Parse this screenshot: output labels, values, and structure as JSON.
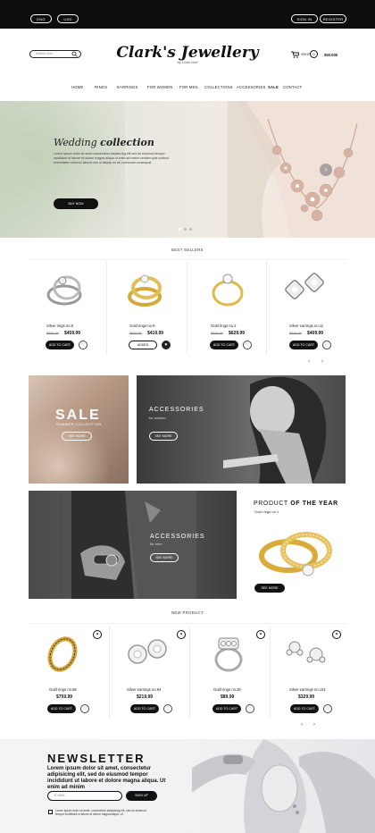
{
  "topbar": {
    "lang": "ENG",
    "currency": "USD",
    "sign_in": "SIGN IN",
    "register": "REGISTER"
  },
  "header": {
    "search_placeholder": "Search here",
    "logo": "Clark's Jewellery",
    "logo_sub": "by Clark Doe",
    "shop_label": "SHOP",
    "cart_count": "0",
    "cart_total": "$50.00$"
  },
  "nav": [
    "HOME",
    "RINGS",
    "EARRINGS",
    "FOR WOMEN",
    "FOR MEN",
    "COLLECTIONS",
    "ACCESSORIES",
    "SALE",
    "CONTACT"
  ],
  "hero": {
    "title_light": "Wedding",
    "title_bold": "collection",
    "text": "Lorem ipsum dolor sit amet consectetur adipisicing elit sed do eiusmod tempor incididunt ut labore et dolore magna aliqua ut enim ad minim veniam quis nostrud exercitation ullamco laboris nisi ut aliquip ex ea commodo consequat",
    "button": "BUY NOW"
  },
  "best_sellers": {
    "title": "BEST SELLERS",
    "items": [
      {
        "name": "Silver rings no.5",
        "old": "$688.99",
        "price": "$459.99",
        "button": "ADD TO CART"
      },
      {
        "name": "Gold rings no.9",
        "old": "$699.99",
        "price": "$419.99",
        "button": "ADDED"
      },
      {
        "name": "Gold rings no.2",
        "old": "$899.99",
        "price": "$629.99",
        "button": "ADD TO CART"
      },
      {
        "name": "Silver earrings no.11",
        "old": "$699.99",
        "price": "$409.99",
        "button": "ADD TO CART"
      }
    ]
  },
  "promo": {
    "sale_title": "SALE",
    "sale_sub": "SUMMER COLLECTION",
    "sale_button": "SEE MORE",
    "acc_women_title": "ACCESSORIES",
    "acc_women_sub": "for women",
    "acc_women_button": "SEE MORE",
    "acc_men_title": "ACCESSORIES",
    "acc_men_sub": "for men",
    "acc_men_button": "SEE MORE",
    "poty_title_light": "PRODUCT",
    "poty_title_bold": "OF THE YEAR",
    "poty_item": "Gold rings no.1",
    "poty_button": "SEE MORE"
  },
  "new_products": {
    "title": "NEW PRODUCT",
    "items": [
      {
        "name": "Gold rings no.58",
        "price": "$759.99",
        "button": "ADD TO CART"
      },
      {
        "name": "Silver earrings no.94",
        "price": "$219.99",
        "button": "ADD TO CART"
      },
      {
        "name": "Gold rings no.28",
        "price": "$89.99",
        "button": "ADD TO CART"
      },
      {
        "name": "Silver earrings no.151",
        "price": "$329.99",
        "button": "ADD TO CART"
      }
    ]
  },
  "newsletter": {
    "title": "NEWSLETTER",
    "text": "Lorem ipsum dolor sit amet, consectetur adipisicing elit, sed do eiusmod tempor incididunt ut labore et dolore magna aliqua. Ut enim ad minim",
    "email_placeholder": "E-MAIL",
    "button": "SIGN UP",
    "consent": "Lorem ipsum dolor sit amet, consectetur adipisicing elit, sed do eiusmod tempor incididunt ut labore et dolore magna aliqua. Ut"
  },
  "colors": {
    "accent": "#111111",
    "background": "#ffffff"
  }
}
